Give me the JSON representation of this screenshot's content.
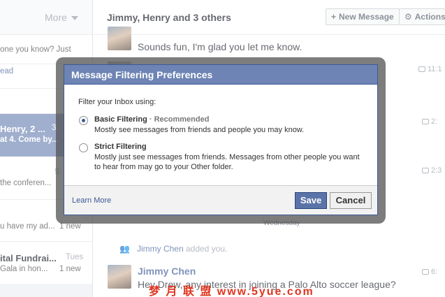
{
  "sidebar": {
    "more_label": "More",
    "threads": [
      {
        "line1": "one you know? Just",
        "line2": "",
        "time": "",
        "new_label": ""
      },
      {
        "line1": "ead",
        "line2": "",
        "time": "",
        "new_label": ""
      },
      {
        "line1": "Henry, 2 ...",
        "line2": "at 4. Come by...",
        "time": "3:",
        "new_label": ""
      },
      {
        "line1": "the conferen...",
        "line2": "",
        "time": "9:",
        "new_label": ""
      },
      {
        "line1": "u have my ad...",
        "line2": "",
        "time": "",
        "new_label": "1 new"
      },
      {
        "line1": "ital Fundrai...",
        "line2": "Gala in hon...",
        "time": "Tues",
        "new_label": "1 new"
      }
    ]
  },
  "header": {
    "conversation_title": "Jimmy, Henry and 3 others",
    "new_message_label": "New Message",
    "actions_label": "Actions"
  },
  "messages": {
    "first_text": "Sounds fun, I'm glad you let me know.",
    "times": [
      "11:1",
      "2:",
      "2:3"
    ],
    "day_divider": "Wednesday",
    "added_event_name": "Jimmy Chen",
    "added_event_text": "added you.",
    "sender_name": "Jimmy Chen",
    "last_text": "Hey Drew, any interest in joining a Palo Alto soccer league?",
    "last_time": "6:"
  },
  "dialog": {
    "title": "Message Filtering Preferences",
    "prompt": "Filter your Inbox using:",
    "basic_title": "Basic Filtering",
    "basic_badge": "· Recommended",
    "basic_desc": "Mostly see messages from friends and people you may know.",
    "strict_title": "Strict Filtering",
    "strict_desc": "Mostly just see messages from friends. Messages from other people you want to hear from may go to your Other folder.",
    "learn_more": "Learn More",
    "save_label": "Save",
    "cancel_label": "Cancel"
  },
  "watermark": "梦 月 联 盟  www.5yue.com"
}
